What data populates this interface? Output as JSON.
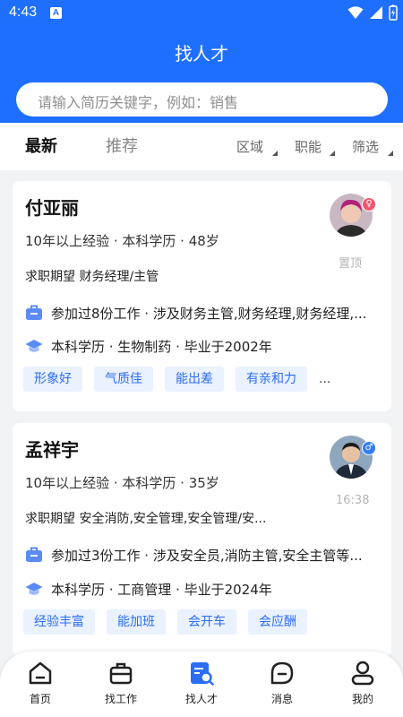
{
  "status": {
    "time": "4:43",
    "app_badge": "A"
  },
  "header": {
    "title": "找人才",
    "search_placeholder": "请输入简历关键字，例如：销售"
  },
  "tabs": {
    "latest": "最新",
    "recommend": "推荐"
  },
  "filters": {
    "region": "区域",
    "position": "职能",
    "filter": "筛选"
  },
  "candidates": [
    {
      "name": "付亚丽",
      "meta": "10年以上经验 · 本科学历 · 48岁",
      "intent": "求职期望 财务经理/主管",
      "work": "参加过8份工作 · 涉及财务主管,财务经理,财务经理,...",
      "education": "本科学历 · 生物制药 · 毕业于2002年",
      "tags": [
        "形象好",
        "气质佳",
        "能出差",
        "有亲和力"
      ],
      "more": "...",
      "side_note": "置顶",
      "gender_icon": "female-icon",
      "gender_color": "#f2566d"
    },
    {
      "name": "孟祥宇",
      "meta": "10年以上经验 · 本科学历 · 35岁",
      "intent": "求职期望 安全消防,安全管理,安全管理/安...",
      "work": "参加过3份工作 · 涉及安全员,消防主管,安全主管等...",
      "education": "本科学历 · 工商管理 · 毕业于2024年",
      "tags": [
        "经验丰富",
        "能加班",
        "会开车",
        "会应酬"
      ],
      "side_note": "16:38",
      "gender_icon": "male-icon",
      "gender_color": "#2f7cf6"
    }
  ],
  "nav": {
    "home": "首页",
    "find_job": "找工作",
    "find_talent": "找人才",
    "messages": "消息",
    "mine": "我的"
  },
  "colors": {
    "brand": "#1f6fff",
    "tag_bg": "#eaf1ff",
    "tag_text": "#2b6ef2",
    "icon_accent": "#5b8cf5"
  }
}
